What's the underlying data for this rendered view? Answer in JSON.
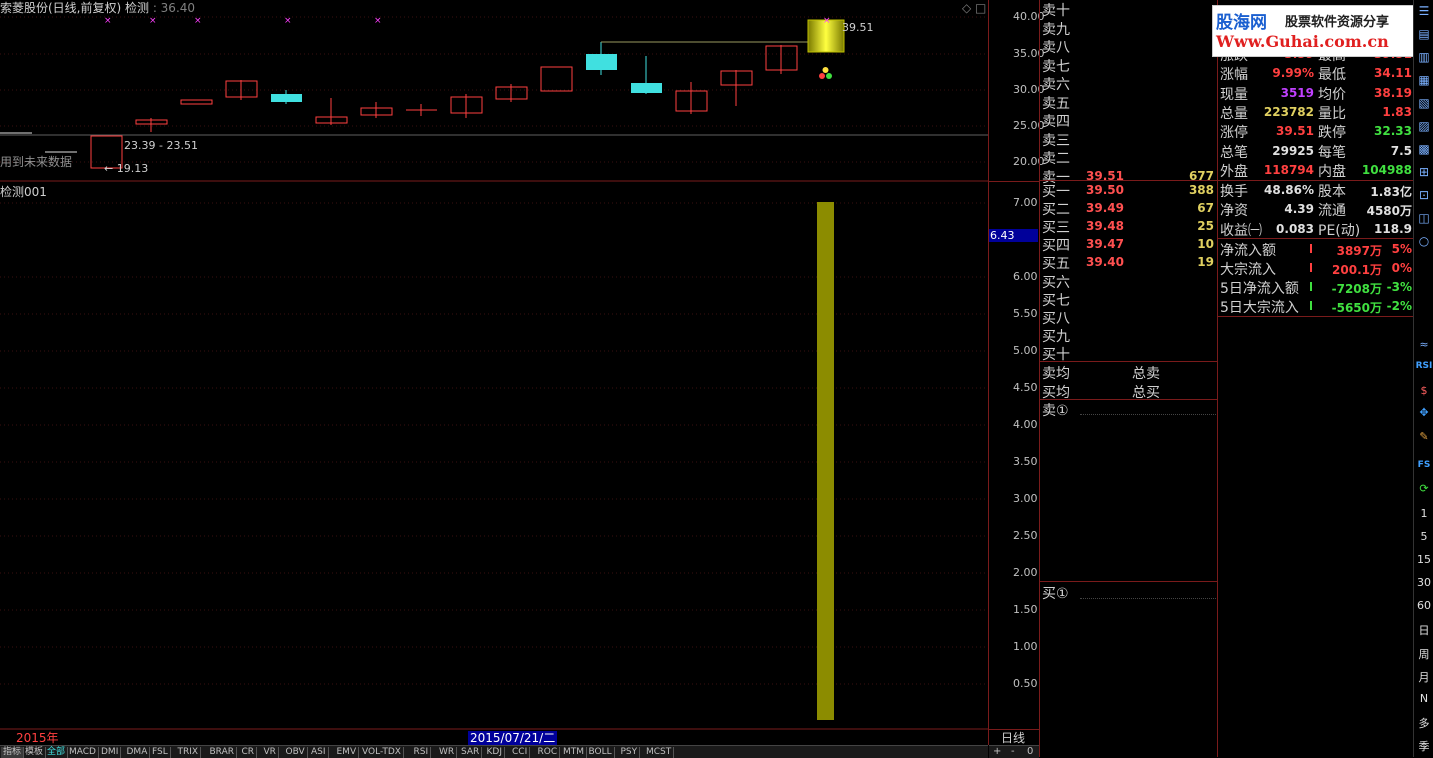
{
  "header": {
    "title": "索菱股份(日线,前复权) 检测",
    "price_label": "36.40",
    "future_data_note": "用到未来数据"
  },
  "indicator": {
    "name": "检测001",
    "current_value": "6.43"
  },
  "price_axis": [
    "40.00",
    "35.00",
    "30.00",
    "25.00",
    "20.00"
  ],
  "indicator_axis": [
    "7.00",
    "6.00",
    "5.50",
    "5.00",
    "4.50",
    "4.00",
    "3.50",
    "3.00",
    "2.50",
    "2.00",
    "1.50",
    "1.00",
    "0.50"
  ],
  "annotations": {
    "high_label": "39.51",
    "range_label": "23.39 - 23.51",
    "low_label": "← 19.13"
  },
  "timeline": {
    "year": "2015年",
    "cursor_date": "2015/07/21/二",
    "period": "日线"
  },
  "bottom_tabs": [
    "指标",
    "模板",
    "全部",
    "MACD",
    "DMI",
    "DMA",
    "FSL",
    "TRIX",
    "BRAR",
    "CR",
    "VR",
    "OBV",
    "ASI",
    "EMV",
    "VOL-TDX",
    "RSI",
    "WR",
    "SAR",
    "KDJ",
    "CCI",
    "ROC",
    "MTM",
    "BOLL",
    "PSY",
    "MCST"
  ],
  "axis_controls": [
    "+",
    "-",
    "0"
  ],
  "order_book": {
    "sell": [
      {
        "label": "卖十",
        "price": "",
        "vol": ""
      },
      {
        "label": "卖九",
        "price": "",
        "vol": ""
      },
      {
        "label": "卖八",
        "price": "",
        "vol": ""
      },
      {
        "label": "卖七",
        "price": "",
        "vol": ""
      },
      {
        "label": "卖六",
        "price": "",
        "vol": ""
      },
      {
        "label": "卖五",
        "price": "",
        "vol": ""
      },
      {
        "label": "卖四",
        "price": "",
        "vol": ""
      },
      {
        "label": "卖三",
        "price": "",
        "vol": ""
      },
      {
        "label": "卖二",
        "price": "",
        "vol": ""
      },
      {
        "label": "卖一",
        "price": "39.51",
        "vol": "677"
      }
    ],
    "buy": [
      {
        "label": "买一",
        "price": "39.50",
        "vol": "388"
      },
      {
        "label": "买二",
        "price": "39.49",
        "vol": "67"
      },
      {
        "label": "买三",
        "price": "39.48",
        "vol": "25"
      },
      {
        "label": "买四",
        "price": "39.47",
        "vol": "10"
      },
      {
        "label": "买五",
        "price": "39.40",
        "vol": "19"
      },
      {
        "label": "买六",
        "price": "",
        "vol": ""
      },
      {
        "label": "买七",
        "price": "",
        "vol": ""
      },
      {
        "label": "买八",
        "price": "",
        "vol": ""
      },
      {
        "label": "买九",
        "price": "",
        "vol": ""
      },
      {
        "label": "买十",
        "price": "",
        "vol": ""
      }
    ],
    "avg_sell": "卖均",
    "total_sell": "总卖",
    "avg_buy": "买均",
    "total_buy": "总买",
    "sell_detail": "卖①",
    "buy_detail": "买①"
  },
  "logo": {
    "brand": "股海网",
    "slogan": "股票软件资源分享",
    "url": "Www.Guhai.com.cn"
  },
  "stats": [
    {
      "l1": "涨跌",
      "v1": "3.59",
      "c1": "#ff4040",
      "l2": "最高",
      "v2": "39.51",
      "c2": "#ff4040"
    },
    {
      "l1": "涨幅",
      "v1": "9.99%",
      "c1": "#ff4040",
      "l2": "最低",
      "v2": "34.11",
      "c2": "#ff4040"
    },
    {
      "l1": "现量",
      "v1": "3519",
      "c1": "#c040ff",
      "l2": "均价",
      "v2": "38.19",
      "c2": "#ff4040"
    },
    {
      "l1": "总量",
      "v1": "223782",
      "c1": "#e0d060",
      "l2": "量比",
      "v2": "1.83",
      "c2": "#ff4040"
    },
    {
      "l1": "涨停",
      "v1": "39.51",
      "c1": "#ff4040",
      "l2": "跌停",
      "v2": "32.33",
      "c2": "#40e040"
    },
    {
      "l1": "总笔",
      "v1": "29925",
      "c1": "#e0e0e0",
      "l2": "每笔",
      "v2": "7.5",
      "c2": "#e0e0e0"
    },
    {
      "l1": "外盘",
      "v1": "118794",
      "c1": "#ff4040",
      "l2": "内盘",
      "v2": "104988",
      "c2": "#40e040"
    }
  ],
  "stats2": [
    {
      "l1": "换手",
      "v1": "48.86%",
      "c1": "#e0e0e0",
      "l2": "股本",
      "v2": "1.83亿",
      "c2": "#e0e0e0"
    },
    {
      "l1": "净资",
      "v1": "4.39",
      "c1": "#e0e0e0",
      "l2": "流通",
      "v2": "4580万",
      "c2": "#e0e0e0"
    },
    {
      "l1": "收益㈠",
      "v1": "0.083",
      "c1": "#e0e0e0",
      "l2": "PE(动)",
      "v2": "118.9",
      "c2": "#e0e0e0"
    }
  ],
  "flows": [
    {
      "label": "净流入额",
      "value": "3897万",
      "pct": "5%",
      "color": "#ff4040"
    },
    {
      "label": "大宗流入",
      "value": "200.1万",
      "pct": "0%",
      "color": "#ff4040"
    },
    {
      "label": "5日净流入额",
      "value": "-7208万",
      "pct": "-3%",
      "color": "#40e040"
    },
    {
      "label": "5日大宗流入",
      "value": "-5650万",
      "pct": "-2%",
      "color": "#40e040"
    }
  ],
  "right_toolbar": [
    "1",
    "5",
    "15",
    "30",
    "60",
    "日",
    "周",
    "月",
    "N",
    "多",
    "季"
  ],
  "right_toolbar_icons": [
    "RSI",
    "FS"
  ],
  "colors": {
    "up": "#ff4040",
    "down": "#40e0e0",
    "bar": "#8c8c00",
    "grid": "#7a1b1b"
  }
}
